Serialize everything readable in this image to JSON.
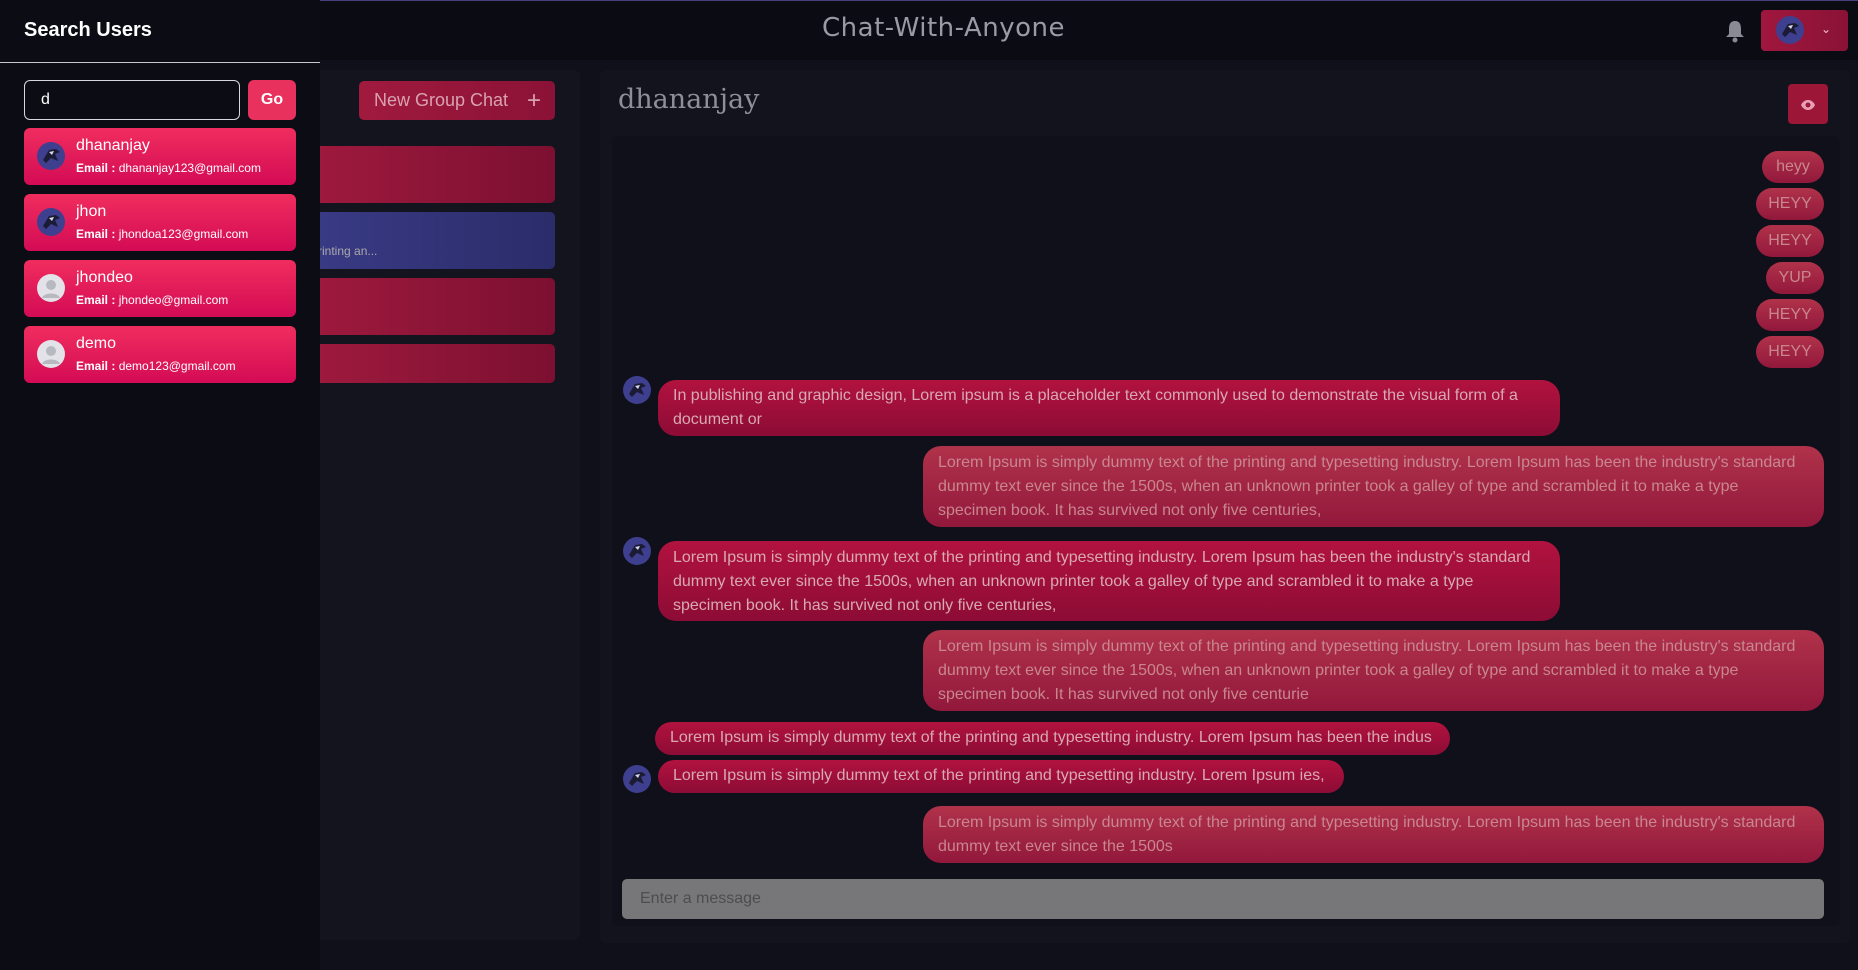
{
  "header": {
    "app_title": "Chat-With-Anyone"
  },
  "chat_list": {
    "new_group_label": "New Group Chat",
    "visible_preview": "rinting an..."
  },
  "chat": {
    "name": "dhananjay",
    "input_placeholder": "Enter a message",
    "messages": [
      {
        "text": "heyy"
      },
      {
        "text": "HEYY"
      },
      {
        "text": "HEYY"
      },
      {
        "text": "YUP"
      },
      {
        "text": "HEYY"
      },
      {
        "text": "HEYY"
      },
      {
        "text": "In publishing and graphic design, Lorem ipsum is a placeholder text commonly used to demonstrate the visual form of a document or"
      },
      {
        "text": "Lorem Ipsum is simply dummy text of the printing and typesetting industry. Lorem Ipsum has been the industry's standard dummy text ever since the 1500s, when an unknown printer took a galley of type and scrambled it to make a type specimen book. It has survived not only five centuries,"
      },
      {
        "text": "Lorem Ipsum is simply dummy text of the printing and typesetting industry. Lorem Ipsum has been the industry's standard dummy text ever since the 1500s, when an unknown printer took a galley of type and scrambled it to make a type specimen book. It has survived not only five centuries,"
      },
      {
        "text": "Lorem Ipsum is simply dummy text of the printing and typesetting industry. Lorem Ipsum has been the industry's standard dummy text ever since the 1500s, when an unknown printer took a galley of type and scrambled it to make a type specimen book. It has survived not only five centurie"
      },
      {
        "text": "Lorem Ipsum is simply dummy text of the printing and typesetting industry. Lorem Ipsum has been the indus"
      },
      {
        "text": "Lorem Ipsum is simply dummy text of the printing and typesetting industry. Lorem Ipsum ies,"
      },
      {
        "text": "Lorem Ipsum is simply dummy text of the printing and typesetting industry. Lorem Ipsum has been the industry's standard dummy text ever since the 1500s"
      }
    ]
  },
  "drawer": {
    "title": "Search Users",
    "search_value": "d",
    "go_label": "Go",
    "email_label": "Email :",
    "users": [
      {
        "name": "dhananjay",
        "email": "dhananjay123@gmail.com",
        "avatar": "bird-avatar"
      },
      {
        "name": "jhon",
        "email": "jhondoa123@gmail.com",
        "avatar": "bird-avatar"
      },
      {
        "name": "jhondeo",
        "email": "jhondeo@gmail.com",
        "avatar": "default-avatar"
      },
      {
        "name": "demo",
        "email": "demo123@gmail.com",
        "avatar": "default-avatar"
      }
    ]
  },
  "colors": {
    "accent": "#e8315d",
    "background": "#0f1019",
    "sent_bubble": "#b0324a",
    "received_bubble": "#b2123f"
  }
}
